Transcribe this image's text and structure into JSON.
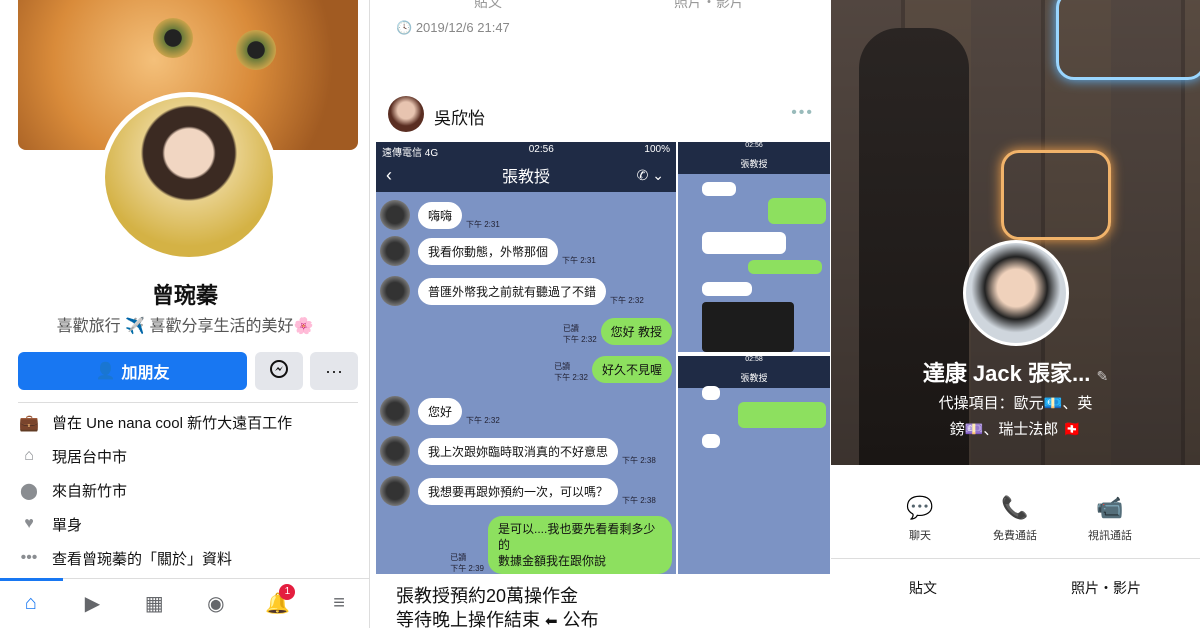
{
  "left_profile": {
    "name": "曾琬蓁",
    "bio": "喜歡旅行 ✈️  喜歡分享生活的美好🌸",
    "add_friend_label": "加朋友",
    "messenger_icon": "messenger-icon",
    "more_label": "···",
    "info": [
      {
        "icon": "briefcase-icon",
        "text": "曾在 Une nana cool 新竹大遠百工作"
      },
      {
        "icon": "home-icon",
        "text": "現居台中市"
      },
      {
        "icon": "location-icon",
        "text": "來自新竹市"
      },
      {
        "icon": "heart-icon",
        "text": "單身"
      },
      {
        "icon": "dots-icon",
        "text": "查看曾琬蓁的「關於」資料"
      }
    ],
    "nav": {
      "notification_count": "1"
    }
  },
  "middle_post": {
    "timestamp": "2019/12/6 21:47",
    "top_left_faded": "貼文",
    "top_right_faded": "照片・影片",
    "poster_name": "吳欣怡",
    "chat": {
      "carrier": "遠傳電信 4G",
      "time": "02:56",
      "battery": "100%",
      "title": "張教授",
      "read_label": "已讀",
      "messages": [
        {
          "side": "left",
          "text": "嗨嗨",
          "time": "下午 2:31"
        },
        {
          "side": "left",
          "text": "我看你動態，外幣那個",
          "time": "下午 2:31"
        },
        {
          "side": "left",
          "text": "普匯外幣我之前就有聽過了不錯",
          "time": "下午 2:32"
        },
        {
          "side": "right",
          "text": "您好 教授",
          "time": "下午 2:32"
        },
        {
          "side": "right",
          "text": "好久不見喔",
          "time": "下午 2:32"
        },
        {
          "side": "left",
          "text": "您好",
          "time": "下午 2:32"
        },
        {
          "side": "left",
          "text": "我上次跟妳臨時取消真的不好意思",
          "time": "下午 2:38"
        },
        {
          "side": "left",
          "text": "我想要再跟妳預約一次，可以嗎？",
          "time": "下午 2:38"
        },
        {
          "side": "right",
          "text": "是可以....我也要先看看剩多少的",
          "time": "下午 2:39"
        },
        {
          "side": "right",
          "text": "數據金額我在跟你說",
          "time": ""
        }
      ],
      "mini_top_time": "02:56",
      "mini_bottom_time": "02:58",
      "mini_title": "張教授"
    },
    "caption_line1": "張教授預約20萬操作金",
    "caption_line2": "等待晚上操作結束",
    "caption_end": "公布"
  },
  "right_profile": {
    "name": "達康 Jack 張家...",
    "line1": "代操項目：歐元💶、英",
    "line2": "鎊💷、瑞士法郎 🇨🇭",
    "actions": [
      {
        "icon": "chat-icon",
        "label": "聊天"
      },
      {
        "icon": "phone-icon",
        "label": "免費通話"
      },
      {
        "icon": "video-icon",
        "label": "視訊通話"
      }
    ],
    "tabs": [
      "貼文",
      "照片・影片"
    ]
  }
}
